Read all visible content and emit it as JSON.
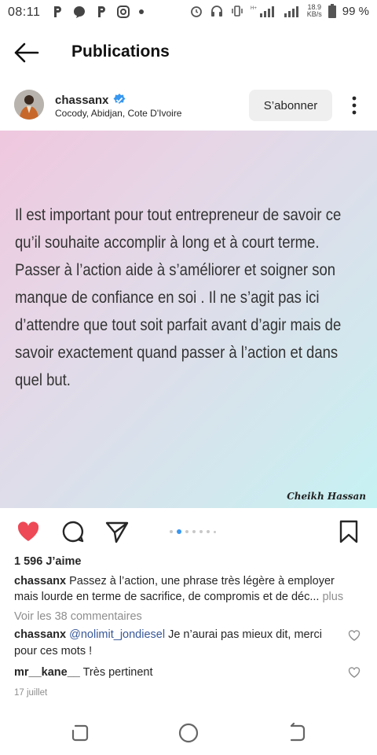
{
  "status_bar": {
    "time": "08:11",
    "network_speed_value": "18.9",
    "network_speed_unit": "KB/s",
    "battery": "99 %"
  },
  "app_bar": {
    "title": "Publications"
  },
  "post": {
    "username": "chassanx",
    "location": "Cocody, Abidjan, Cote D'Ivoire",
    "follow_label": "S’abonner",
    "quote_lines": [
      " Il est important pour tout entrepreneur de savoir ce qu’il souhaite accomplir à long et à court terme.",
      "Passer à l’action aide à s’améliorer et soigner son manque de confiance en soi . Il ne s’agit pas ici d’attendre que tout soit parfait avant d’agir mais de savoir exactement quand passer à l’action et dans quel but."
    ],
    "signature": "Cheikh Hassan",
    "likes": "1 596 J’aime",
    "caption_username": "chassanx",
    "caption_text": " Passez à l’action, une phrase très légère à employer mais lourde en terme de sacrifice, de compromis et de déc... ",
    "caption_more": "plus",
    "view_comments": "Voir les 38 commentaires",
    "comments": [
      {
        "user": "chassanx",
        "mention": "@nolimit_jondiesel",
        "text": " Je n’aurai pas mieux dit, merci pour ces mots !"
      },
      {
        "user": "mr__kane__",
        "mention": "",
        "text": " Très pertinent"
      }
    ],
    "date": "17 juillet"
  },
  "colors": {
    "like_red": "#ed4956",
    "accent_blue": "#3897f0",
    "mention_blue": "#385898"
  },
  "icons": [
    "back-arrow-icon",
    "verified-badge-icon",
    "more-vert-icon",
    "heart-filled-icon",
    "comment-icon",
    "share-icon",
    "bookmark-icon",
    "heart-outline-icon",
    "recents-icon",
    "home-icon",
    "back-nav-icon"
  ]
}
